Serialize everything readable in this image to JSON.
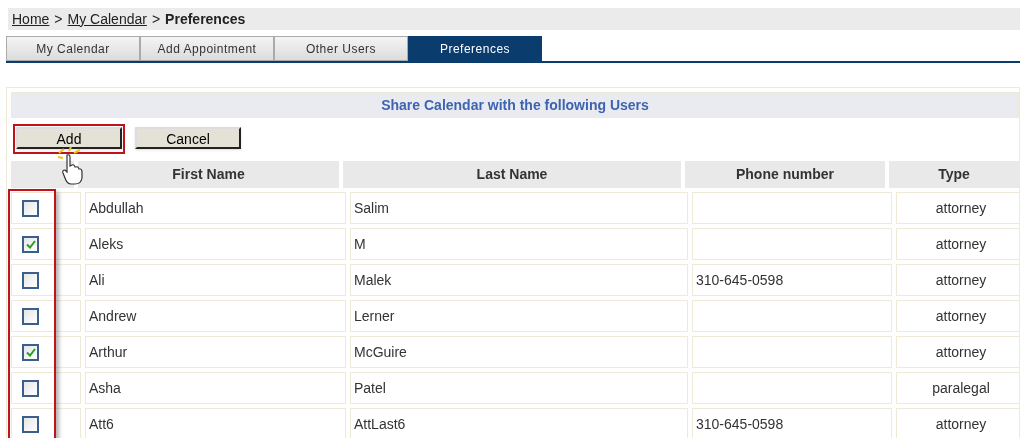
{
  "breadcrumb": [
    {
      "label": "Home",
      "kind": "link"
    },
    {
      "label": ">",
      "kind": "separator"
    },
    {
      "label": "My Calendar",
      "kind": "link"
    },
    {
      "label": ">",
      "kind": "separator"
    },
    {
      "label": "Preferences",
      "kind": "current"
    }
  ],
  "tabs": [
    {
      "label": "My Calendar",
      "selected": false
    },
    {
      "label": "Add Appointment",
      "selected": false
    },
    {
      "label": "Other Users",
      "selected": false
    },
    {
      "label": "Preferences",
      "selected": true
    }
  ],
  "panel_title": "Share Calendar with the following Users",
  "buttons": [
    {
      "label": "Add",
      "highlighted": true
    },
    {
      "label": "Cancel",
      "highlighted": false
    }
  ],
  "table": {
    "columns": [
      "First Name",
      "Last Name",
      "Phone number",
      "Type"
    ],
    "rows": [
      {
        "checked": false,
        "first_name": "Abdullah",
        "last_name": "Salim",
        "phone": "",
        "type": "attorney"
      },
      {
        "checked": true,
        "first_name": "Aleks",
        "last_name": "M",
        "phone": "",
        "type": "attorney"
      },
      {
        "checked": false,
        "first_name": "Ali",
        "last_name": "Malek",
        "phone": "310-645-0598",
        "type": "attorney"
      },
      {
        "checked": false,
        "first_name": "Andrew",
        "last_name": "Lerner",
        "phone": "",
        "type": "attorney"
      },
      {
        "checked": true,
        "first_name": "Arthur",
        "last_name": "McGuire",
        "phone": "",
        "type": "attorney"
      },
      {
        "checked": false,
        "first_name": "Asha",
        "last_name": "Patel",
        "phone": "",
        "type": "paralegal"
      },
      {
        "checked": false,
        "first_name": "Att6",
        "last_name": "AttLast6",
        "phone": "310-645-0598",
        "type": "attorney"
      }
    ]
  }
}
